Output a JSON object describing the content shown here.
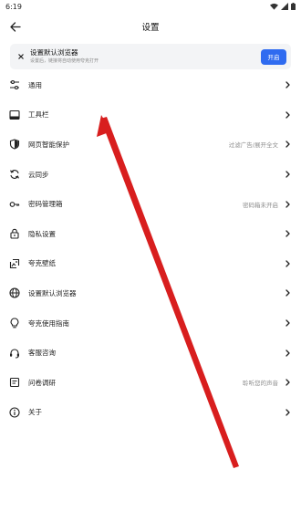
{
  "status_bar": {
    "time": "6:19"
  },
  "header": {
    "title": "设置"
  },
  "banner": {
    "title": "设置默认浏览器",
    "subtitle": "设置后，链接将自动使用夸克打开",
    "button_label": "开启"
  },
  "settings": [
    {
      "icon": "sliders-icon",
      "label": "通用",
      "value": ""
    },
    {
      "icon": "toolbar-icon",
      "label": "工具栏",
      "value": ""
    },
    {
      "icon": "shield-icon",
      "label": "网页智能保护",
      "value": "过滤广告/展开全文"
    },
    {
      "icon": "sync-icon",
      "label": "云同步",
      "value": ""
    },
    {
      "icon": "key-icon",
      "label": "密码管理箱",
      "value": "密码箱未开启"
    },
    {
      "icon": "lock-icon",
      "label": "隐私设置",
      "value": ""
    },
    {
      "icon": "wallpaper-icon",
      "label": "夸克壁纸",
      "value": ""
    },
    {
      "icon": "globe-icon",
      "label": "设置默认浏览器",
      "value": ""
    },
    {
      "icon": "lightbulb-icon",
      "label": "夸克使用指南",
      "value": ""
    },
    {
      "icon": "headset-icon",
      "label": "客服咨询",
      "value": ""
    },
    {
      "icon": "survey-icon",
      "label": "问卷调研",
      "value": "聆听您的声音"
    },
    {
      "icon": "info-icon",
      "label": "关于",
      "value": ""
    }
  ],
  "colors": {
    "accent": "#2f6bf0",
    "annotation_arrow": "#d81e1e"
  }
}
